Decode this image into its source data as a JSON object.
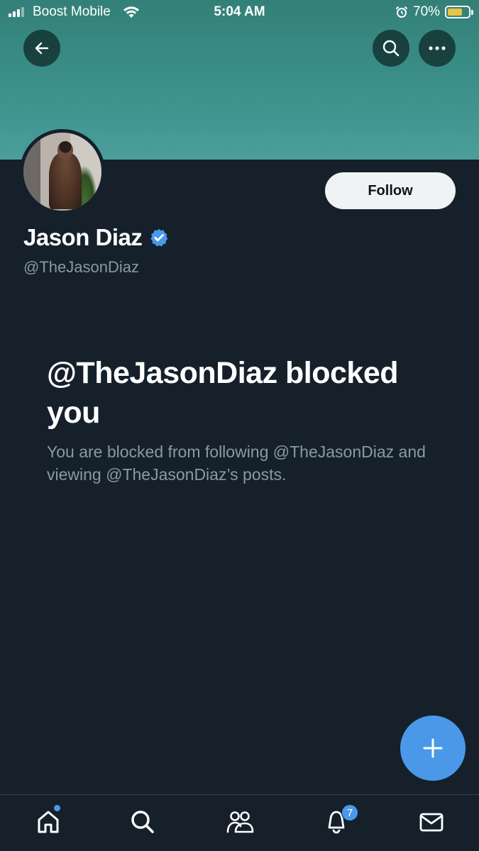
{
  "status_bar": {
    "carrier": "Boost Mobile",
    "time": "5:04 AM",
    "battery_percent": "70%",
    "battery_level": 0.7,
    "battery_color": "#f5c842"
  },
  "header": {
    "back_icon": "arrow-left-icon",
    "search_icon": "search-icon",
    "more_icon": "more-horizontal-icon",
    "banner_color": "#3a8f88"
  },
  "profile": {
    "display_name": "Jason Diaz",
    "handle": "@TheJasonDiaz",
    "verified": true,
    "verified_color": "#4a99e9",
    "follow_label": "Follow"
  },
  "blocked_notice": {
    "title": "@TheJasonDiaz blocked you",
    "description": "You are blocked from following @TheJasonDiaz and viewing @TheJasonDiaz’s posts."
  },
  "compose": {
    "icon": "plus-icon",
    "color": "#4a99e9"
  },
  "tab_bar": {
    "items": [
      {
        "name": "home",
        "icon": "home-icon",
        "has_dot": true
      },
      {
        "name": "search",
        "icon": "search-icon"
      },
      {
        "name": "communities",
        "icon": "communities-icon"
      },
      {
        "name": "notifications",
        "icon": "bell-icon",
        "badge": "7"
      },
      {
        "name": "messages",
        "icon": "mail-icon"
      }
    ]
  }
}
